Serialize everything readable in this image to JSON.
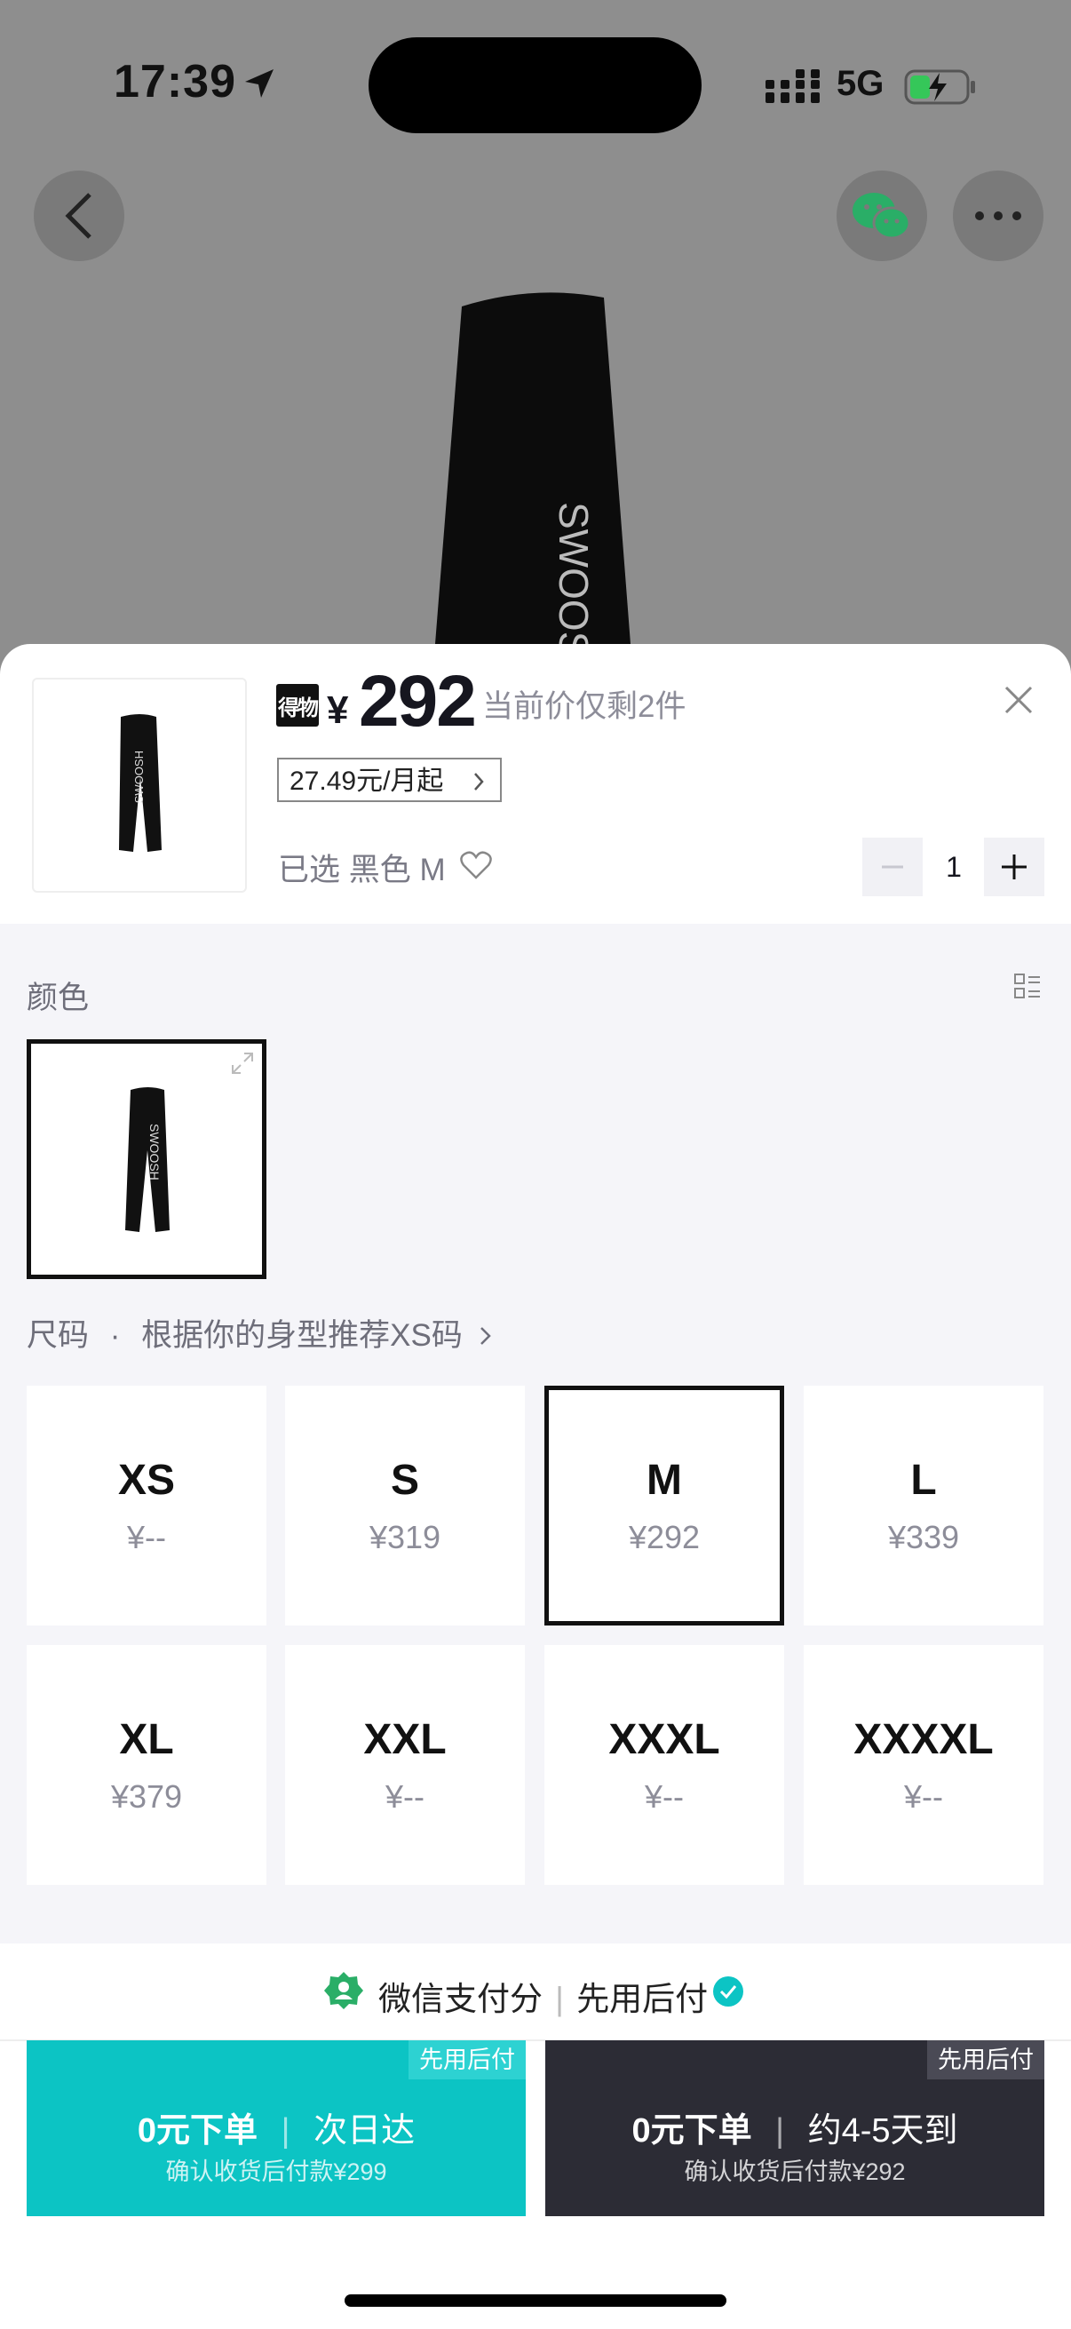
{
  "status": {
    "time": "17:39",
    "network": "5G"
  },
  "sheet": {
    "brand_logo": "得物",
    "currency": "¥",
    "price": "292",
    "stock_note": "当前价仅剩2件",
    "installment": "27.49元/月起",
    "selected_prefix": "已选",
    "selected_value": "黑色 M",
    "quantity": "1"
  },
  "color_section": {
    "label": "颜色"
  },
  "size_section": {
    "label": "尺码",
    "dot": "·",
    "recommend": "根据你的身型推荐XS码",
    "sizes": [
      {
        "name": "XS",
        "price": "¥--"
      },
      {
        "name": "S",
        "price": "¥319"
      },
      {
        "name": "M",
        "price": "¥292"
      },
      {
        "name": "L",
        "price": "¥339"
      },
      {
        "name": "XL",
        "price": "¥379"
      },
      {
        "name": "XXL",
        "price": "¥--"
      },
      {
        "name": "XXXL",
        "price": "¥--"
      },
      {
        "name": "XXXXL",
        "price": "¥--"
      }
    ]
  },
  "wxpay": {
    "left": "微信支付分",
    "sep": "|",
    "right": "先用后付"
  },
  "buttons": [
    {
      "tag": "先用后付",
      "main": "0元下单",
      "sep": "|",
      "delivery": "次日达",
      "sub": "确认收货后付款¥299"
    },
    {
      "tag": "先用后付",
      "main": "0元下单",
      "sep": "|",
      "delivery": "约4-5天到",
      "sub": "确认收货后付款¥292"
    }
  ],
  "colors": {
    "accent": "#0cc4c4",
    "dark_button": "#2c2c35",
    "wechat_green": "#2aae67"
  }
}
